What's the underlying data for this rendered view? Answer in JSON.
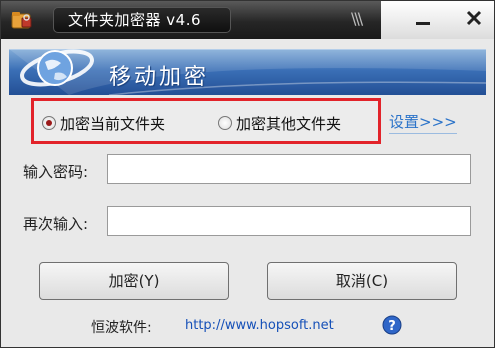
{
  "window": {
    "title": "文件夹加密器 v4.6",
    "stripes": "\\\\\\"
  },
  "banner": {
    "title": "移动加密"
  },
  "options": {
    "radio_current": "加密当前文件夹",
    "radio_other": "加密其他文件夹",
    "selected": "radio_current",
    "settings_link": "设置>>>"
  },
  "form": {
    "password_label": "输入密码:",
    "password_value": "",
    "confirm_label": "再次输入:",
    "confirm_value": ""
  },
  "buttons": {
    "encrypt": "加密(Y)",
    "cancel": "取消(C)"
  },
  "footer": {
    "label": "恒波软件:",
    "url": "http://www.hopsoft.net"
  },
  "colors": {
    "highlight_border": "#e2232a",
    "banner_blue": "#3a6fb6",
    "link_blue": "#2b73c9"
  },
  "icons": [
    "app-folder-icon",
    "minimize-icon",
    "close-icon",
    "globe-icon",
    "help-icon"
  ]
}
